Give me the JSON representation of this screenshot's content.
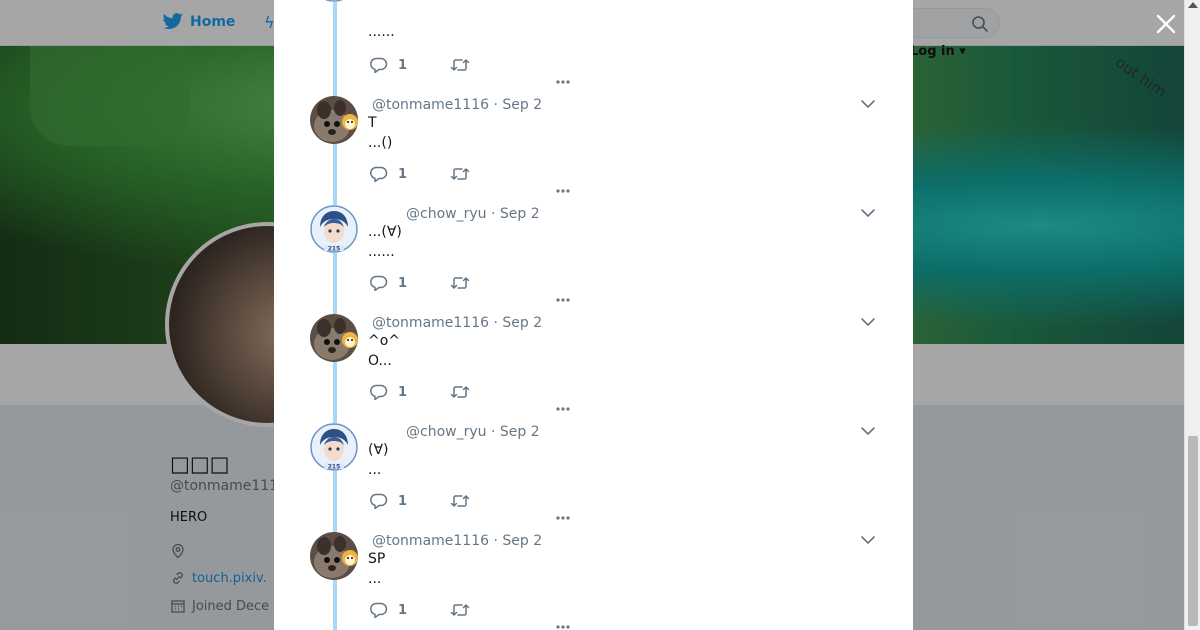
{
  "nav": {
    "home_label": "Home",
    "moments_glyph": "ϟ",
    "login_label": "Log in"
  },
  "banner": {
    "overlay_text": "out him"
  },
  "profile": {
    "name": "□□□",
    "handle": "@tonmame111",
    "bio": "HERO",
    "website": "touch.pixiv.",
    "joined": "Joined Dece"
  },
  "thread": {
    "partial_top": {
      "line2": "......",
      "reply_count": "1"
    },
    "tweets": [
      {
        "author_key": "tonmame",
        "handle": "@tonmame1116",
        "date": "Sep 2",
        "line1": "T",
        "line2": "...()",
        "reply_count": "1"
      },
      {
        "author_key": "chow",
        "handle": "@chow_ryu",
        "date": "Sep 2",
        "line1": "...(∀)",
        "line2": "......",
        "reply_count": "1"
      },
      {
        "author_key": "tonmame",
        "handle": "@tonmame1116",
        "date": "Sep 2",
        "line1": "^o^",
        "line2": "O...",
        "reply_count": "1"
      },
      {
        "author_key": "chow",
        "handle": "@chow_ryu",
        "date": "Sep 2",
        "line1": "(∀)",
        "line2": "...",
        "reply_count": "1"
      },
      {
        "author_key": "tonmame",
        "handle": "@tonmame1116",
        "date": "Sep 2",
        "line1": "SP",
        "line2": "...",
        "reply_count": "1"
      }
    ]
  },
  "colors": {
    "accent": "#1da1f2",
    "thread_line": "#aad7f6",
    "muted_text": "#657786",
    "overlay": "rgba(0,0,0,0.35)"
  },
  "icons": {
    "home": "bird-icon",
    "search": "search-icon",
    "close": "close-icon",
    "reply": "reply-icon",
    "retweet": "retweet-icon",
    "chevron": "chevron-down-icon",
    "location": "location-icon",
    "link": "link-icon",
    "calendar": "calendar-icon"
  }
}
